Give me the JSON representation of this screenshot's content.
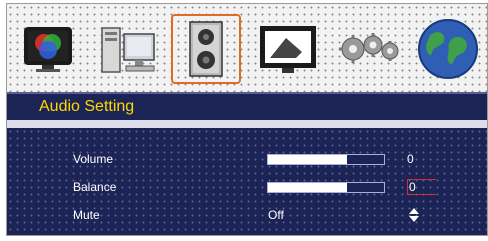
{
  "icons": [
    {
      "name": "picture-icon"
    },
    {
      "name": "computer-icon"
    },
    {
      "name": "speaker-icon",
      "selected": true
    },
    {
      "name": "display-icon"
    },
    {
      "name": "gears-icon"
    },
    {
      "name": "globe-icon"
    }
  ],
  "header": {
    "title": "Audio Setting"
  },
  "settings": {
    "volume": {
      "label": "Volume",
      "value": "0",
      "level": 0.68
    },
    "balance": {
      "label": "Balance",
      "value": "0",
      "level": 0.68
    },
    "mute": {
      "label": "Mute",
      "value": "Off"
    }
  },
  "colors": {
    "panel": "#1c2456",
    "title": "#ffd800",
    "selection": "#e06a2a",
    "focus": "#d03030"
  }
}
